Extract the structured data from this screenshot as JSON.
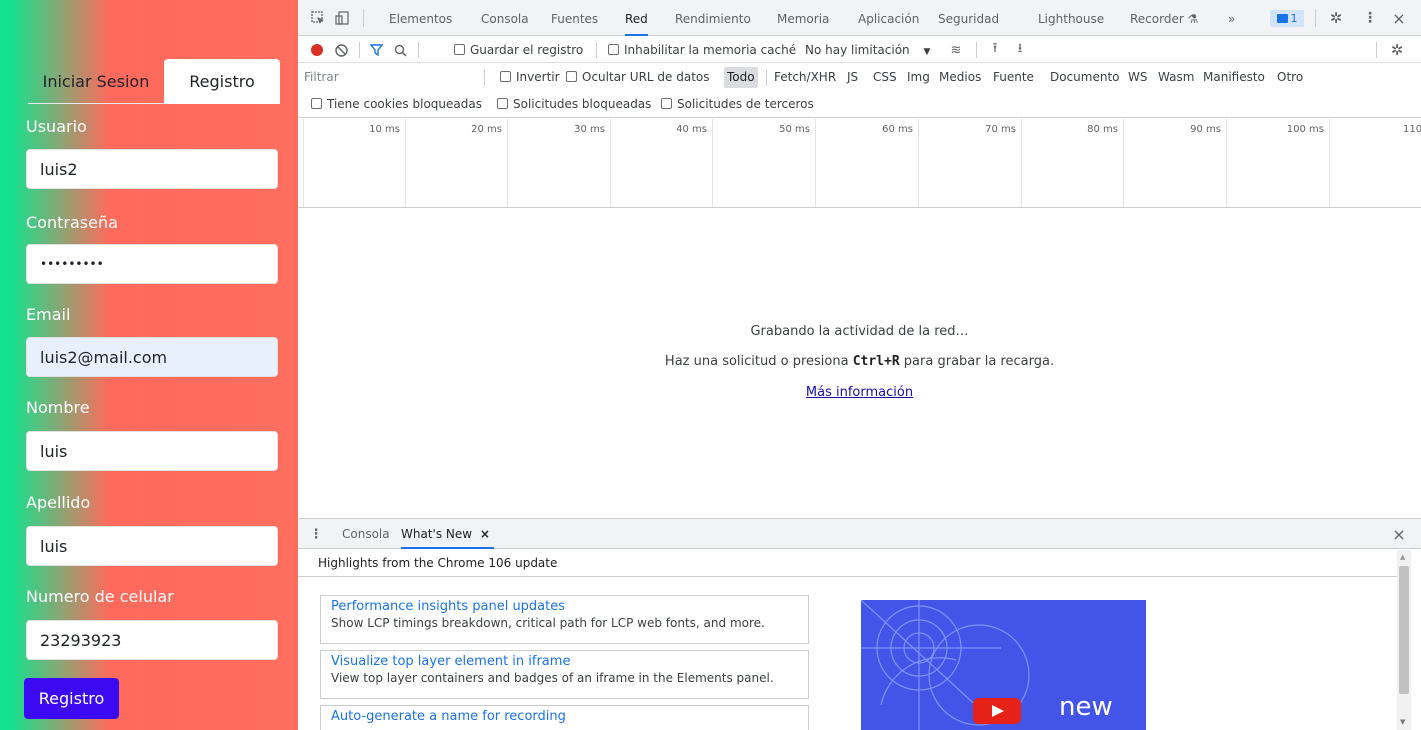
{
  "auth": {
    "tabs": {
      "login": "Iniciar Sesion",
      "register": "Registro"
    },
    "fields": [
      {
        "label": "Usuario",
        "value": "luis2"
      },
      {
        "label": "Contraseña",
        "value": "•••••••••"
      },
      {
        "label": "Email",
        "value": "luis2@mail.com"
      },
      {
        "label": "Nombre",
        "value": "luis"
      },
      {
        "label": "Apellido",
        "value": "luis"
      },
      {
        "label": "Numero de celular",
        "value": "23293923"
      }
    ],
    "submit_label": "Registro",
    "colors": {
      "gradient_start": "#13e28e",
      "gradient_end": "#fd6e5f",
      "button": "#3b09f2"
    }
  },
  "devtools": {
    "tabs": [
      "Elementos",
      "Consola",
      "Fuentes",
      "Red",
      "Rendimiento",
      "Memoria",
      "Aplicación",
      "Seguridad",
      "Lighthouse",
      "Recorder ⚗"
    ],
    "active_tab": "Red",
    "more_tabs": "»",
    "issues_badge": "1",
    "toolbar": {
      "preserve_log": "Guardar el registro",
      "disable_cache": "Inhabilitar la memoria caché",
      "throttling": "No hay limitación"
    },
    "filter": {
      "placeholder": "Filtrar",
      "invert": "Invertir",
      "hide_data_urls": "Ocultar URL de datos",
      "types": [
        "Todo",
        "Fetch/XHR",
        "JS",
        "CSS",
        "Img",
        "Medios",
        "Fuente",
        "Documento",
        "WS",
        "Wasm",
        "Manifiesto",
        "Otro"
      ],
      "active_type": "Todo",
      "blocked_cookies": "Tiene cookies bloqueadas",
      "blocked_requests": "Solicitudes bloqueadas",
      "third_party": "Solicitudes de terceros"
    },
    "timeline_ticks": [
      "10 ms",
      "20 ms",
      "30 ms",
      "40 ms",
      "50 ms",
      "60 ms",
      "70 ms",
      "80 ms",
      "90 ms",
      "100 ms",
      "110"
    ],
    "empty": {
      "line1": "Grabando la actividad de la red…",
      "line2_before": "Haz una solicitud o presiona ",
      "line2_key": "Ctrl+R",
      "line2_after": " para grabar la recarga.",
      "link": "Más información"
    },
    "drawer": {
      "tabs": [
        "Consola",
        "What's New"
      ],
      "active_tab": "What's New",
      "close_tab": "×",
      "headline": "Highlights from the Chrome 106 update",
      "cards": [
        {
          "title": "Performance insights panel updates",
          "desc": "Show LCP timings breakdown, critical path for LCP web fonts, and more."
        },
        {
          "title": "Visualize top layer element in iframe",
          "desc": "View top layer containers and badges of an iframe in the Elements panel."
        },
        {
          "title": "Auto-generate a name for recording",
          "desc": ""
        }
      ],
      "promo_word": "new"
    }
  }
}
